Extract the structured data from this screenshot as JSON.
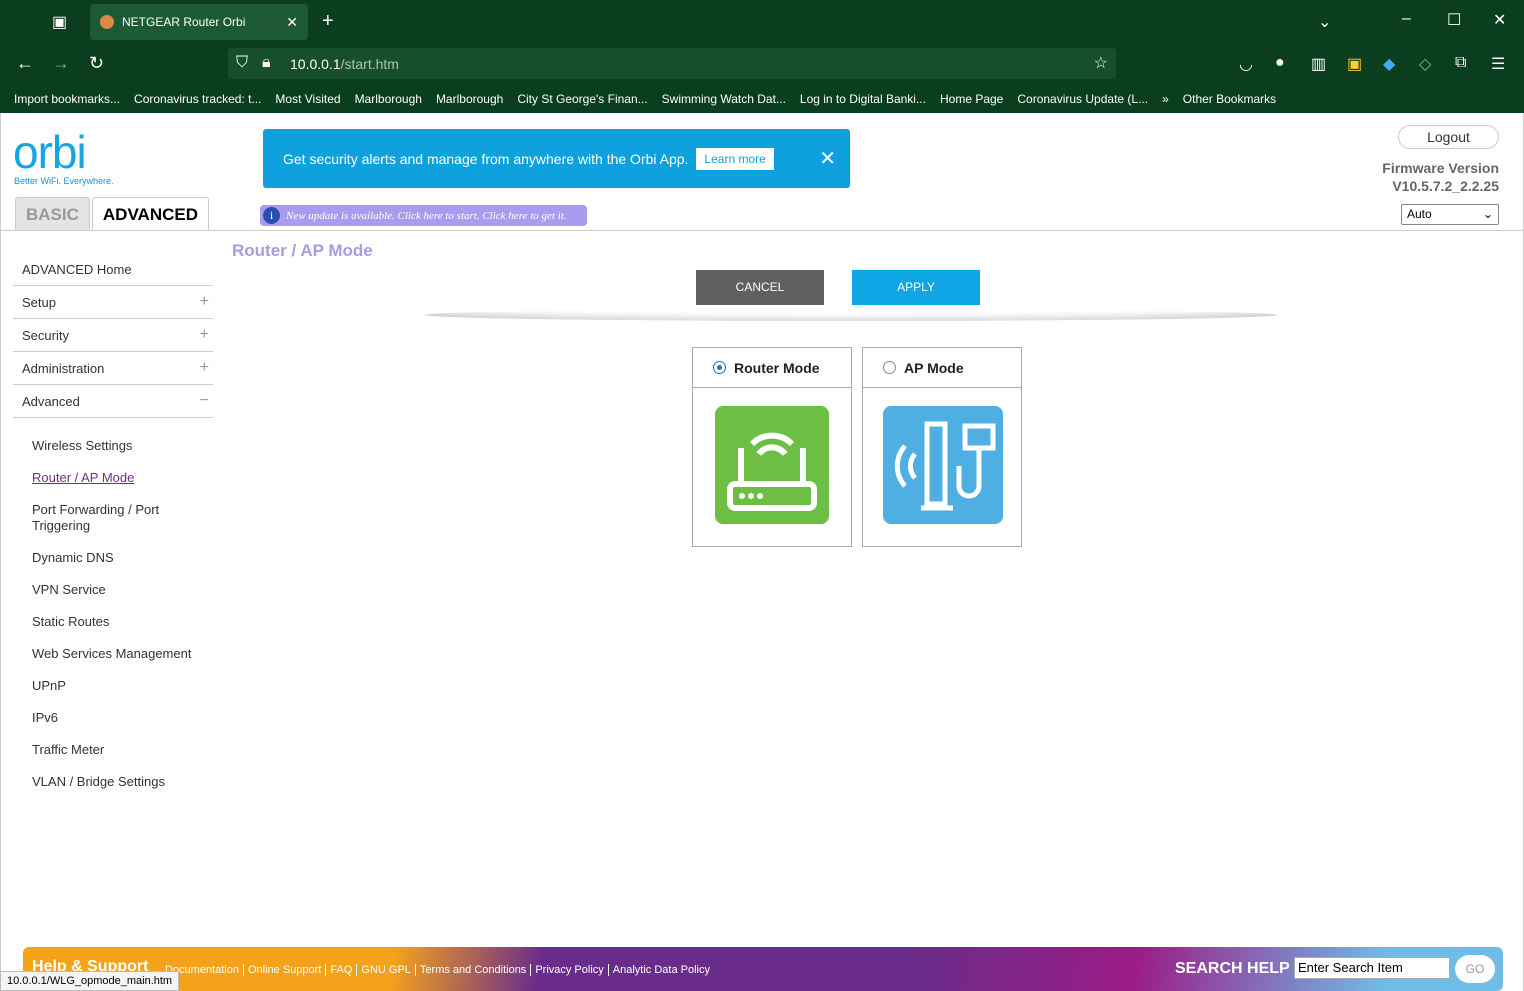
{
  "browser": {
    "tab_title": "NETGEAR Router Orbi",
    "url_host": "10.0.0.1",
    "url_path": "/start.htm",
    "bookmarks": [
      "Import bookmarks...",
      "Coronavirus tracked: t...",
      "Most Visited",
      "Marlborough",
      "Marlborough",
      "City St George's Finan...",
      "Swimming Watch Dat...",
      "Log in to Digital Banki...",
      "Home Page",
      "Coronavirus Update (L...",
      "Other Bookmarks"
    ]
  },
  "header": {
    "logo": "orbi",
    "tagline": "Better WiFi. Everywhere.",
    "banner_text": "Get security alerts and manage from anywhere with the Orbi App.",
    "learn_more": "Learn more",
    "tab_basic": "BASIC",
    "tab_advanced": "ADVANCED",
    "update_notice": "New update is available. Click here to start. Click here to get it.",
    "logout": "Logout",
    "firmware_label": "Firmware Version",
    "firmware_version": "V10.5.7.2_2.2.25",
    "language_select": "Auto"
  },
  "sidebar": {
    "items": [
      {
        "label": "ADVANCED Home",
        "toggle": ""
      },
      {
        "label": "Setup",
        "toggle": "+"
      },
      {
        "label": "Security",
        "toggle": "+"
      },
      {
        "label": "Administration",
        "toggle": "+"
      },
      {
        "label": "Advanced",
        "toggle": "−"
      }
    ],
    "subitems": [
      "Wireless Settings",
      "Router / AP Mode",
      "Port Forwarding / Port Triggering",
      "Dynamic DNS",
      "VPN Service",
      "Static Routes",
      "Web Services Management",
      "UPnP",
      "IPv6",
      "Traffic Meter",
      "VLAN / Bridge Settings"
    ]
  },
  "main": {
    "title": "Router / AP Mode",
    "cancel": "CANCEL",
    "apply": "APPLY",
    "router_mode": "Router Mode",
    "ap_mode": "AP Mode",
    "selected": "Router Mode"
  },
  "footer": {
    "help": "Help & Support",
    "links": [
      "Documentation",
      "Online Support",
      "FAQ",
      "GNU GPL",
      "Terms and Conditions",
      "Privacy Policy",
      "Analytic Data Policy"
    ],
    "search_label": "SEARCH HELP",
    "search_placeholder": "Enter Search Item",
    "go": "GO"
  },
  "status_bar": "10.0.0.1/WLG_opmode_main.htm"
}
